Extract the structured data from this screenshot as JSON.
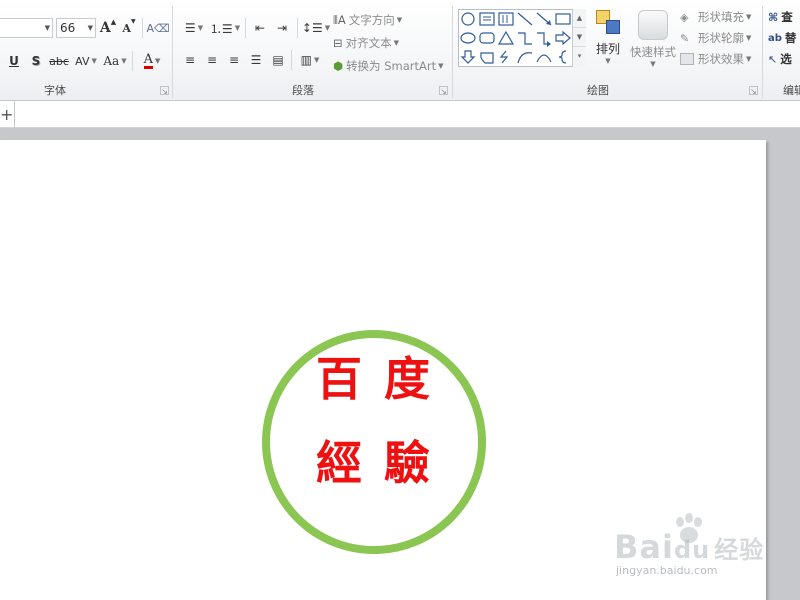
{
  "ribbon": {
    "font_group": {
      "label": "字体",
      "font_size": "66",
      "grow_font": "A",
      "shrink_font": "A",
      "underline": "U",
      "shadow": "S",
      "strikethrough": "abc",
      "char_spacing": "AV",
      "change_case": "Aa",
      "font_color": "A"
    },
    "paragraph_group": {
      "label": "段落",
      "text_direction": "文字方向",
      "align_text": "对齐文本",
      "convert_smartart": "转换为 SmartArt"
    },
    "drawing_group": {
      "label": "绘图",
      "arrange": "排列",
      "quick_styles": "快速样式",
      "shape_fill": "形状填充",
      "shape_outline": "形状轮廓",
      "shape_effects": "形状效果"
    },
    "editing_group": {
      "label": "编辑",
      "find": "查",
      "replace": "替",
      "select": "选"
    }
  },
  "slide": {
    "seal_chars": [
      "百",
      "度",
      "經",
      "驗"
    ],
    "seal_ring_color": "#8cc652",
    "seal_text_color": "#ee1111"
  },
  "watermark": {
    "brand_prefix": "Bai",
    "brand_suffix": "du",
    "brand_cn": "经验",
    "url": "jingyan.baidu.com"
  }
}
